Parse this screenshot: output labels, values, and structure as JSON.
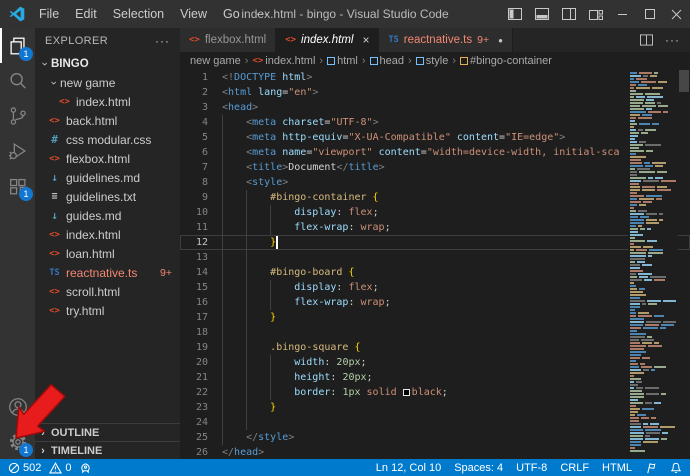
{
  "titlebar": {
    "menus": [
      "File",
      "Edit",
      "Selection",
      "View",
      "Go",
      "···"
    ],
    "title": "index.html - bingo - Visual Studio Code"
  },
  "activitybar": {
    "items": [
      {
        "name": "explorer",
        "icon": "files-icon",
        "badge": "1",
        "active": true
      },
      {
        "name": "search",
        "icon": "search-icon"
      },
      {
        "name": "source-control",
        "icon": "git-branch-icon"
      },
      {
        "name": "run-and-debug",
        "icon": "debug-icon"
      },
      {
        "name": "extensions",
        "icon": "extensions-icon",
        "badge": "1"
      }
    ],
    "bottom": [
      {
        "name": "accounts",
        "icon": "account-icon"
      },
      {
        "name": "manage",
        "icon": "gear-icon",
        "badge": "1"
      }
    ]
  },
  "sidebar": {
    "title": "EXPLORER",
    "more": "···",
    "root": {
      "label": "BINGO",
      "expanded": true
    },
    "files": [
      {
        "label": "new game",
        "type": "folder",
        "depth": 1,
        "expanded": true
      },
      {
        "label": "index.html",
        "type": "html",
        "depth": 2
      },
      {
        "label": "back.html",
        "type": "html",
        "depth": 1
      },
      {
        "label": "css modular.css",
        "type": "css",
        "depth": 1
      },
      {
        "label": "flexbox.html",
        "type": "html",
        "depth": 1
      },
      {
        "label": "guidelines.md",
        "type": "md",
        "depth": 1
      },
      {
        "label": "guidelines.txt",
        "type": "txt",
        "depth": 1
      },
      {
        "label": "guides.md",
        "type": "md",
        "depth": 1
      },
      {
        "label": "index.html",
        "type": "html",
        "depth": 1
      },
      {
        "label": "loan.html",
        "type": "html",
        "depth": 1
      },
      {
        "label": "reactnative.ts",
        "type": "ts",
        "depth": 1,
        "badge": "9+",
        "error": true
      },
      {
        "label": "scroll.html",
        "type": "html",
        "depth": 1
      },
      {
        "label": "try.html",
        "type": "html",
        "depth": 1
      }
    ],
    "sections": [
      {
        "label": "OUTLINE"
      },
      {
        "label": "TIMELINE"
      }
    ]
  },
  "tabs": [
    {
      "label": "flexbox.html",
      "icon": "html",
      "active": false
    },
    {
      "label": "index.html",
      "icon": "html",
      "active": true,
      "italic": true,
      "close": "×"
    },
    {
      "label": "reactnative.ts",
      "icon": "ts",
      "badge": "9+",
      "dirty": "●",
      "error": true
    }
  ],
  "breadcrumbs": [
    {
      "label": "new game"
    },
    {
      "label": "index.html",
      "icon": "html"
    },
    {
      "label": "html",
      "icon": "symbol-blue"
    },
    {
      "label": "head",
      "icon": "symbol-blue"
    },
    {
      "label": "style",
      "icon": "symbol-blue"
    },
    {
      "label": "#bingo-container",
      "icon": "symbol-orange"
    }
  ],
  "code": {
    "current_line": 12,
    "cursor": {
      "line": 12,
      "col": 10
    },
    "lines": [
      {
        "n": 1,
        "ind": 0,
        "g": 0,
        "seg": [
          [
            "pg",
            "<!"
          ],
          [
            "tag",
            "DOCTYPE"
          ],
          [
            "pl",
            " "
          ],
          [
            "attr",
            "html"
          ],
          [
            "pg",
            ">"
          ]
        ]
      },
      {
        "n": 2,
        "ind": 0,
        "g": 0,
        "seg": [
          [
            "pg",
            "<"
          ],
          [
            "tag",
            "html"
          ],
          [
            "pl",
            " "
          ],
          [
            "attr",
            "lang"
          ],
          [
            "eq",
            "="
          ],
          [
            "str",
            "\"en\""
          ],
          [
            "pg",
            ">"
          ]
        ]
      },
      {
        "n": 3,
        "ind": 0,
        "g": 0,
        "seg": [
          [
            "pg",
            "<"
          ],
          [
            "tag",
            "head"
          ],
          [
            "pg",
            ">"
          ]
        ]
      },
      {
        "n": 4,
        "ind": 4,
        "g": 1,
        "seg": [
          [
            "pg",
            "<"
          ],
          [
            "tag",
            "meta"
          ],
          [
            "pl",
            " "
          ],
          [
            "attr",
            "charset"
          ],
          [
            "eq",
            "="
          ],
          [
            "str",
            "\"UTF-8\""
          ],
          [
            "pg",
            ">"
          ]
        ]
      },
      {
        "n": 5,
        "ind": 4,
        "g": 1,
        "seg": [
          [
            "pg",
            "<"
          ],
          [
            "tag",
            "meta"
          ],
          [
            "pl",
            " "
          ],
          [
            "attr",
            "http-equiv"
          ],
          [
            "eq",
            "="
          ],
          [
            "str",
            "\"X-UA-Compatible\""
          ],
          [
            "pl",
            " "
          ],
          [
            "attr",
            "content"
          ],
          [
            "eq",
            "="
          ],
          [
            "str",
            "\"IE=edge\""
          ],
          [
            "pg",
            ">"
          ]
        ]
      },
      {
        "n": 6,
        "ind": 4,
        "g": 1,
        "seg": [
          [
            "pg",
            "<"
          ],
          [
            "tag",
            "meta"
          ],
          [
            "pl",
            " "
          ],
          [
            "attr",
            "name"
          ],
          [
            "eq",
            "="
          ],
          [
            "str",
            "\"viewport\""
          ],
          [
            "pl",
            " "
          ],
          [
            "attr",
            "content"
          ],
          [
            "eq",
            "="
          ],
          [
            "str",
            "\"width=device-width, initial-sca"
          ]
        ]
      },
      {
        "n": 7,
        "ind": 4,
        "g": 1,
        "seg": [
          [
            "pg",
            "<"
          ],
          [
            "tag",
            "title"
          ],
          [
            "pg",
            ">"
          ],
          [
            "pl",
            "Document"
          ],
          [
            "pg",
            "</"
          ],
          [
            "tag",
            "title"
          ],
          [
            "pg",
            ">"
          ]
        ]
      },
      {
        "n": 8,
        "ind": 4,
        "g": 1,
        "seg": [
          [
            "pg",
            "<"
          ],
          [
            "tag",
            "style"
          ],
          [
            "pg",
            ">"
          ]
        ]
      },
      {
        "n": 9,
        "ind": 8,
        "g": 2,
        "seg": [
          [
            "sel",
            "#bingo-container"
          ],
          [
            "pl",
            " "
          ],
          [
            "br",
            "{"
          ]
        ]
      },
      {
        "n": 10,
        "ind": 12,
        "g": 3,
        "seg": [
          [
            "prop",
            "display"
          ],
          [
            "pu",
            ":"
          ],
          [
            "pl",
            " "
          ],
          [
            "val",
            "flex"
          ],
          [
            "pu",
            ";"
          ]
        ]
      },
      {
        "n": 11,
        "ind": 12,
        "g": 3,
        "seg": [
          [
            "prop",
            "flex-wrap"
          ],
          [
            "pu",
            ":"
          ],
          [
            "pl",
            " "
          ],
          [
            "val",
            "wrap"
          ],
          [
            "pu",
            ";"
          ]
        ]
      },
      {
        "n": 12,
        "ind": 8,
        "g": 2,
        "seg": [
          [
            "br",
            "}"
          ]
        ]
      },
      {
        "n": 13,
        "ind": 0,
        "g": 2,
        "seg": []
      },
      {
        "n": 14,
        "ind": 8,
        "g": 2,
        "seg": [
          [
            "sel",
            "#bingo-board"
          ],
          [
            "pl",
            " "
          ],
          [
            "br",
            "{"
          ]
        ]
      },
      {
        "n": 15,
        "ind": 12,
        "g": 3,
        "seg": [
          [
            "prop",
            "display"
          ],
          [
            "pu",
            ":"
          ],
          [
            "pl",
            " "
          ],
          [
            "val",
            "flex"
          ],
          [
            "pu",
            ";"
          ]
        ]
      },
      {
        "n": 16,
        "ind": 12,
        "g": 3,
        "seg": [
          [
            "prop",
            "flex-wrap"
          ],
          [
            "pu",
            ":"
          ],
          [
            "pl",
            " "
          ],
          [
            "val",
            "wrap"
          ],
          [
            "pu",
            ";"
          ]
        ]
      },
      {
        "n": 17,
        "ind": 8,
        "g": 2,
        "seg": [
          [
            "br",
            "}"
          ]
        ]
      },
      {
        "n": 18,
        "ind": 0,
        "g": 2,
        "seg": []
      },
      {
        "n": 19,
        "ind": 8,
        "g": 2,
        "seg": [
          [
            "sel",
            ".bingo-square"
          ],
          [
            "pl",
            " "
          ],
          [
            "br",
            "{"
          ]
        ]
      },
      {
        "n": 20,
        "ind": 12,
        "g": 3,
        "seg": [
          [
            "prop",
            "width"
          ],
          [
            "pu",
            ":"
          ],
          [
            "pl",
            " "
          ],
          [
            "num",
            "20px"
          ],
          [
            "pu",
            ";"
          ]
        ]
      },
      {
        "n": 21,
        "ind": 12,
        "g": 3,
        "seg": [
          [
            "prop",
            "height"
          ],
          [
            "pu",
            ":"
          ],
          [
            "pl",
            " "
          ],
          [
            "num",
            "20px"
          ],
          [
            "pu",
            ";"
          ]
        ]
      },
      {
        "n": 22,
        "ind": 12,
        "g": 3,
        "seg": [
          [
            "prop",
            "border"
          ],
          [
            "pu",
            ":"
          ],
          [
            "pl",
            " "
          ],
          [
            "num",
            "1px"
          ],
          [
            "pl",
            " "
          ],
          [
            "val",
            "solid"
          ],
          [
            "pl",
            " "
          ],
          [
            "sw",
            ""
          ],
          [
            "val",
            "black"
          ],
          [
            "pu",
            ";"
          ]
        ]
      },
      {
        "n": 23,
        "ind": 8,
        "g": 2,
        "seg": [
          [
            "br",
            "}"
          ]
        ]
      },
      {
        "n": 24,
        "ind": 0,
        "g": 2,
        "seg": []
      },
      {
        "n": 25,
        "ind": 4,
        "g": 1,
        "seg": [
          [
            "pg",
            "</"
          ],
          [
            "tag",
            "style"
          ],
          [
            "pg",
            ">"
          ]
        ]
      },
      {
        "n": 26,
        "ind": 0,
        "g": 0,
        "seg": [
          [
            "pg",
            "</"
          ],
          [
            "tag",
            "head"
          ],
          [
            "pg",
            ">"
          ]
        ]
      }
    ]
  },
  "statusbar": {
    "left": [
      {
        "name": "errors",
        "icon": "error-icon",
        "text": "502"
      },
      {
        "name": "warnings",
        "icon": "warning-icon",
        "text": "0"
      },
      {
        "name": "remote-indicator",
        "icon": "rocket-icon",
        "text": ""
      }
    ],
    "right": [
      {
        "name": "cursor-position",
        "text": "Ln 12, Col 10"
      },
      {
        "name": "indentation",
        "text": "Spaces: 4"
      },
      {
        "name": "encoding",
        "text": "UTF-8"
      },
      {
        "name": "eol",
        "text": "CRLF"
      },
      {
        "name": "language-mode",
        "text": "HTML"
      }
    ],
    "right_icons": [
      {
        "name": "feedback",
        "icon": "flag-icon"
      },
      {
        "name": "notifications",
        "icon": "bell-icon"
      }
    ]
  },
  "annotation": {
    "arrow_color": "#e81c1c"
  }
}
